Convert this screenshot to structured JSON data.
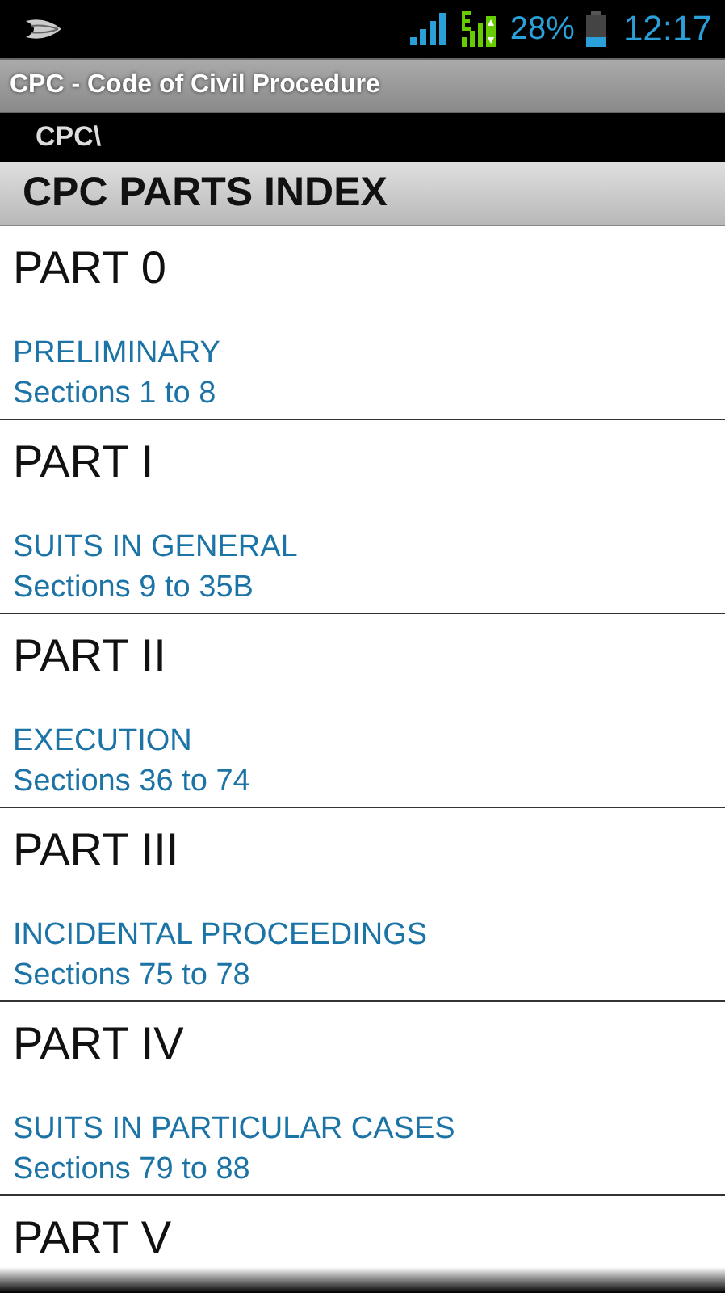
{
  "status_bar": {
    "battery": "28%",
    "time": "12:17"
  },
  "app_title": "CPC - Code of Civil Procedure",
  "breadcrumb": "CPC\\",
  "header": "CPC PARTS INDEX",
  "parts": [
    {
      "title": "PART 0",
      "name": "PRELIMINARY",
      "sections": "Sections 1 to 8"
    },
    {
      "title": "PART I",
      "name": "SUITS IN GENERAL",
      "sections": "Sections 9 to 35B"
    },
    {
      "title": "PART II",
      "name": "EXECUTION",
      "sections": "Sections 36 to 74"
    },
    {
      "title": "PART III",
      "name": "INCIDENTAL PROCEEDINGS",
      "sections": "Sections 75 to 78"
    },
    {
      "title": "PART IV",
      "name": "SUITS IN PARTICULAR CASES",
      "sections": "Sections 79 to 88"
    },
    {
      "title": "PART V"
    }
  ]
}
